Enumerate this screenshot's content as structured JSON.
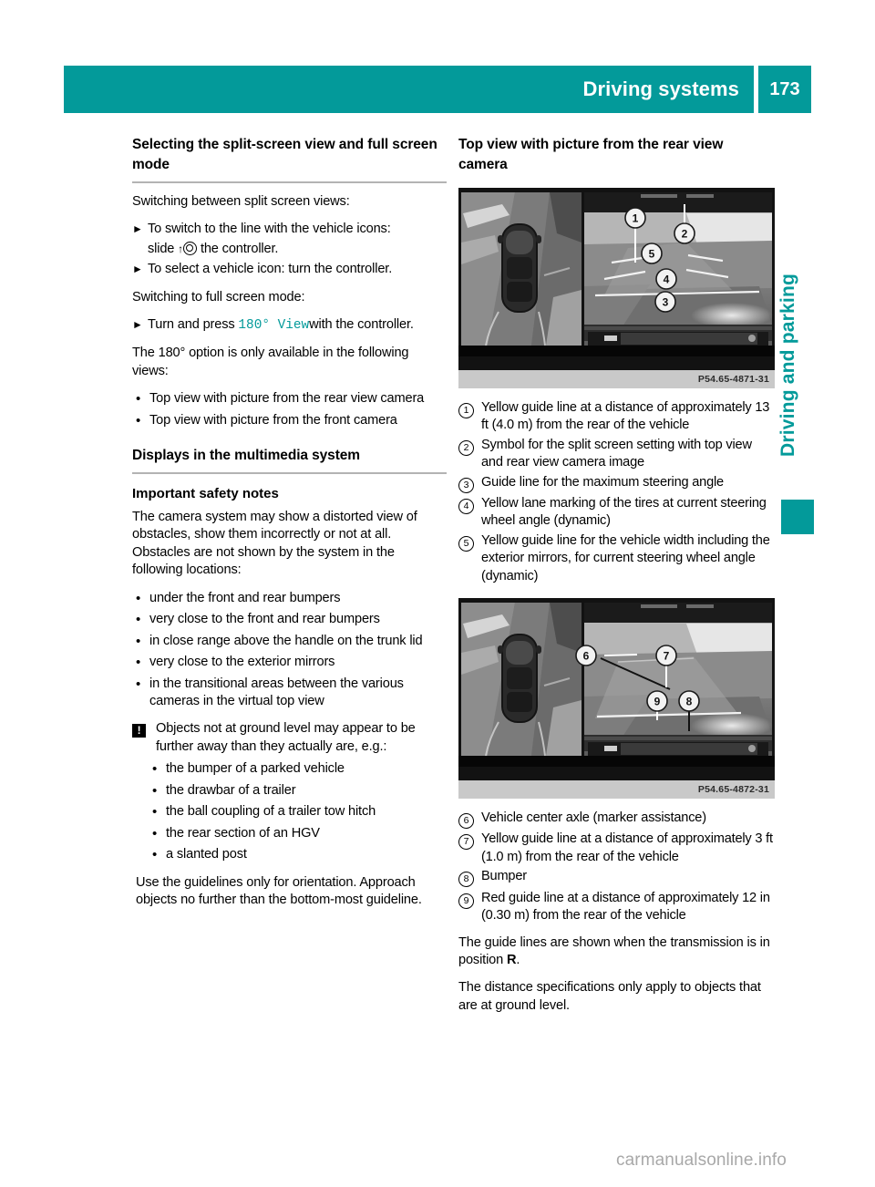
{
  "header": {
    "title": "Driving systems",
    "page_number": "173"
  },
  "side_tab": {
    "label": "Driving and parking"
  },
  "left_column": {
    "heading": "Selecting the split-screen view and full screen mode",
    "intro": "Switching between split screen views:",
    "steps_1": [
      {
        "text_before": "To switch to the line with the vehicle icons: slide ",
        "text_after": " the controller."
      },
      {
        "text_before": "To select a vehicle icon: turn the controller.",
        "text_after": ""
      }
    ],
    "step1_line1": "To switch to the line with the vehicle icons:",
    "step1_line2_pre": "slide",
    "step1_line2_post": "the controller.",
    "step2": "To select a vehicle icon: turn the controller.",
    "intro2": "Switching to full screen mode:",
    "step3_pre": "Turn and press",
    "step3_term": "180° View",
    "step3_post": "with the controller.",
    "note_180": "The 180° option is only available in the following views:",
    "views_list": [
      "Top view with picture from the rear view camera",
      "Top view with picture from the front camera"
    ],
    "heading2": "Displays in the multimedia system",
    "heading3": "Important safety notes",
    "safety_paragraph": "The camera system may show a distorted view of obstacles, show them incorrectly or not at all. Obstacles are not shown by the system in the following locations:",
    "locations_list": [
      "under the front and rear bumpers",
      "very close to the front and rear bumpers",
      "in close range above the handle on the trunk lid",
      "very close to the exterior mirrors",
      "in the transitional areas between the various cameras in the virtual top view"
    ],
    "warning_text": "Objects not at ground level may appear to be further away than they actually are, e.g.:",
    "warning_list": [
      "the bumper of a parked vehicle",
      "the drawbar of a trailer",
      "the ball coupling of a trailer tow hitch",
      "the rear section of an HGV",
      "a slanted post"
    ],
    "closing_paragraph": "Use the guidelines only for orientation. Approach objects no further than the bottom-most guideline."
  },
  "right_column": {
    "heading": "Top view with picture from the rear view camera",
    "figure_1": {
      "id": "P54.65-4871-31",
      "callout_labels": [
        "1",
        "2",
        "3",
        "4",
        "5"
      ]
    },
    "callouts_1": [
      {
        "num": "1",
        "text": "Yellow guide line at a distance of approximately 13 ft (4.0 m) from the rear of the vehicle"
      },
      {
        "num": "2",
        "text": "Symbol for the split screen setting with top view and rear view camera image"
      },
      {
        "num": "3",
        "text": "Guide line for the maximum steering angle"
      },
      {
        "num": "4",
        "text": "Yellow lane marking of the tires at current steering wheel angle (dynamic)"
      },
      {
        "num": "5",
        "text": "Yellow guide line for the vehicle width including the exterior mirrors, for current steering wheel angle (dynamic)"
      }
    ],
    "figure_2": {
      "id": "P54.65-4872-31",
      "callout_labels": [
        "6",
        "7",
        "8",
        "9"
      ]
    },
    "callouts_2": [
      {
        "num": "6",
        "text": "Vehicle center axle (marker assistance)"
      },
      {
        "num": "7",
        "text": "Yellow guide line at a distance of approximately 3 ft (1.0 m) from the rear of the vehicle"
      },
      {
        "num": "8",
        "text": "Bumper"
      },
      {
        "num": "9",
        "text": "Red guide line at a distance of approximately 12 in (0.30 m) from the rear of the vehicle"
      }
    ],
    "tail_1_pre": "The guide lines are shown when the transmission is in position ",
    "tail_1_bold": "R",
    "tail_1_post": ".",
    "tail_2": "The distance specifications only apply to objects that are at ground level."
  },
  "footer": {
    "watermark": "carmanualsonline.info"
  },
  "colors": {
    "accent_teal": "#039a9a",
    "rule_gray": "#b3b3b3",
    "caption_bar_gray": "#c9c9c9"
  }
}
